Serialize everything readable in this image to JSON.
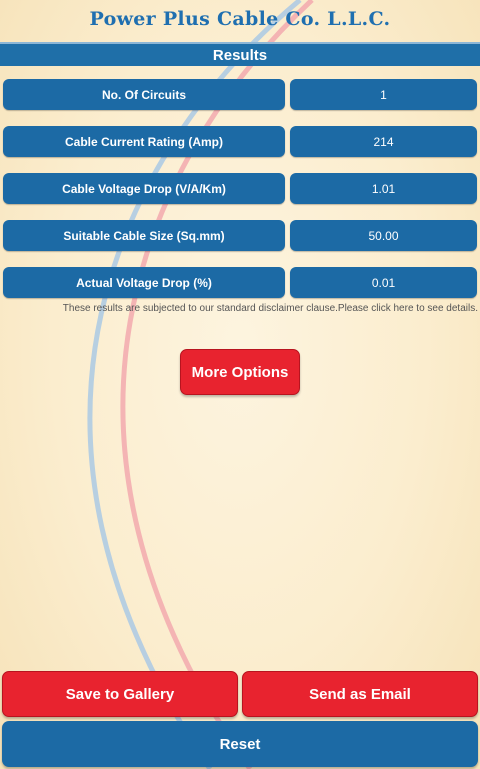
{
  "brand": {
    "title": "Power Plus Cable Co. L.L.C."
  },
  "header": {
    "title": "Results"
  },
  "results": [
    {
      "label": "No. Of Circuits",
      "value": "1"
    },
    {
      "label": "Cable Current Rating (Amp)",
      "value": "214"
    },
    {
      "label": "Cable Voltage Drop (V/A/Km)",
      "value": "1.01"
    },
    {
      "label": "Suitable Cable Size (Sq.mm)",
      "value": "50.00"
    },
    {
      "label": "Actual Voltage Drop (%)",
      "value": "0.01"
    }
  ],
  "disclaimer": "These results are subjected to our standard disclaimer clause.Please click here to see details.",
  "actions": {
    "more_options": "More Options",
    "save_to_gallery": "Save to Gallery",
    "send_as_email": "Send as Email",
    "reset": "Reset"
  },
  "colors": {
    "primary_blue": "#1c6aa5",
    "accent_red": "#e8232f",
    "background": "#fbedce"
  }
}
